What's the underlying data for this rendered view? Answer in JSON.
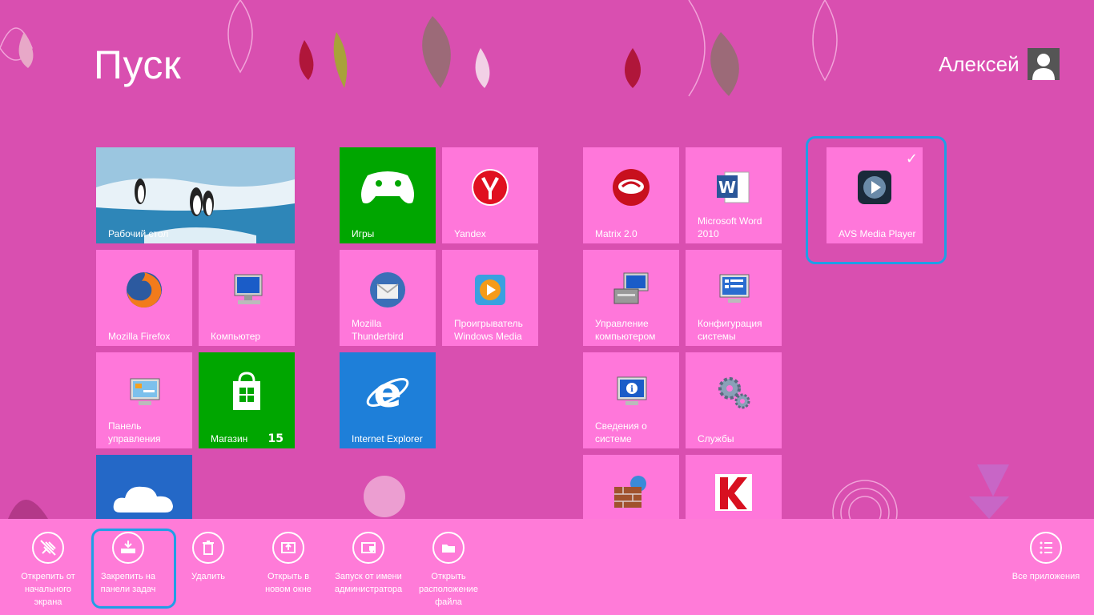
{
  "start": {
    "title": "Пуск",
    "user_name": "Алексей"
  },
  "tiles": {
    "desktop": "Рабочий стол",
    "games": "Игры",
    "yandex": "Yandex",
    "matrix": "Matrix 2.0",
    "word": "Microsoft Word 2010",
    "avs": "AVS Media Player",
    "firefox": "Mozilla Firefox",
    "computer": "Компьютер",
    "thunderbird": "Mozilla Thunderbird",
    "wmp": "Проигрыватель Windows Media",
    "comp_mgmt": "Управление компьютером",
    "sysconfig": "Конфигурация системы",
    "control_panel": "Панель управления",
    "store": "Магазин",
    "store_badge": "15",
    "ie": "Internet Explorer",
    "sysinfo": "Сведения о системе",
    "services": "Службы"
  },
  "appbar": {
    "unpin": "Открепить от\nначального\nэкрана",
    "pin_taskbar": "Закрепить на\nпанели задач",
    "uninstall": "Удалить",
    "new_window": "Открыть в\nновом окне",
    "run_admin": "Запуск от имени\nадминистратора",
    "open_location": "Открыть\nрасположение\nфайла",
    "all_apps": "Все приложения"
  },
  "colors": {
    "background": "#d94fb0",
    "tile": "#ff77da",
    "appbar": "#ff7bd8",
    "selection": "#1f9fe6"
  }
}
